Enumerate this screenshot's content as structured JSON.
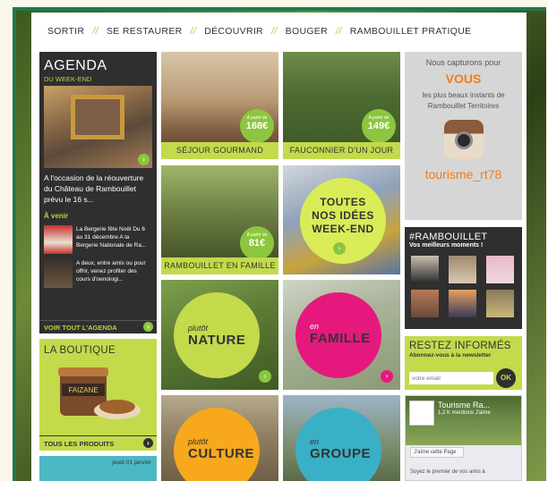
{
  "nav": [
    "SORTIR",
    "SE RESTAURER",
    "DÉCOUVRIR",
    "BOUGER",
    "RAMBOUILLET PRATIQUE"
  ],
  "nav_sep": "//",
  "agenda": {
    "title": "AGENDA",
    "subtitle": "DU WEEK-END",
    "featured_text": "A l'occasion de la réouverture du Château de Rambouillet prévu le 16 s...",
    "a_venir": "À venir",
    "events": [
      "La Bergerie fête Noël Du 6 au 31 décembre A la Bergerie Nationale de Ra...",
      "A deux, entre amis ou pour offrir, venez profiter des cours d'oenologi..."
    ],
    "all_link": "VOIR TOUT L'AGENDA"
  },
  "boutique": {
    "title": "LA BOUTIQUE",
    "footer": "TOUS LES PRODUITS",
    "product_label": "FAIZANE"
  },
  "weather": {
    "date": "jeudi 01 janvier"
  },
  "tiles": {
    "sejour": {
      "label": "SÉJOUR GOURMAND",
      "price_prefix": "A partir de",
      "price": "168€"
    },
    "fauconnier": {
      "label": "FAUCONNIER D'UN JOUR",
      "price_prefix": "A partir de",
      "price": "149€"
    },
    "famille_tile": {
      "label": "RAMBOUILLET EN FAMILLE",
      "price_prefix": "A partir de",
      "price": "81€"
    },
    "idees": {
      "line1": "TOUTES",
      "line2": "NOS IDÉES",
      "line3": "WEEK-END"
    },
    "nature": {
      "pre": "plutôt",
      "main": "NATURE"
    },
    "famille": {
      "pre": "en",
      "main": "FAMILLE"
    },
    "culture": {
      "pre": "plutôt",
      "main": "CULTURE"
    },
    "groupe": {
      "pre": "en",
      "main": "GROUPE"
    }
  },
  "instagram": {
    "line1": "Nous capturons pour",
    "vous": "VOUS",
    "line2": "les plus beaux instants de Rambouillet Territoires",
    "handle": "tourisme_rt78"
  },
  "hashtag": {
    "title": "#RAMBOUILLET",
    "subtitle": "Vos meilleurs moments !"
  },
  "newsletter": {
    "title": "RESTEZ INFORMÉS",
    "subtitle": "Abonnez-vous à la newsletter",
    "placeholder": "votre email",
    "ok": "OK"
  },
  "facebook": {
    "name": "Tourisme Ra...",
    "likes": "1,2 K mentions J'aime",
    "like_button": "J'aime cette Page",
    "first": "Soyez le premier de vos amis à"
  },
  "colors": {
    "accent_green": "#c3da4b",
    "pink": "#e5197d",
    "orange": "#f7a81b",
    "blue": "#3ab0c6",
    "dark": "#2f2f2f"
  }
}
